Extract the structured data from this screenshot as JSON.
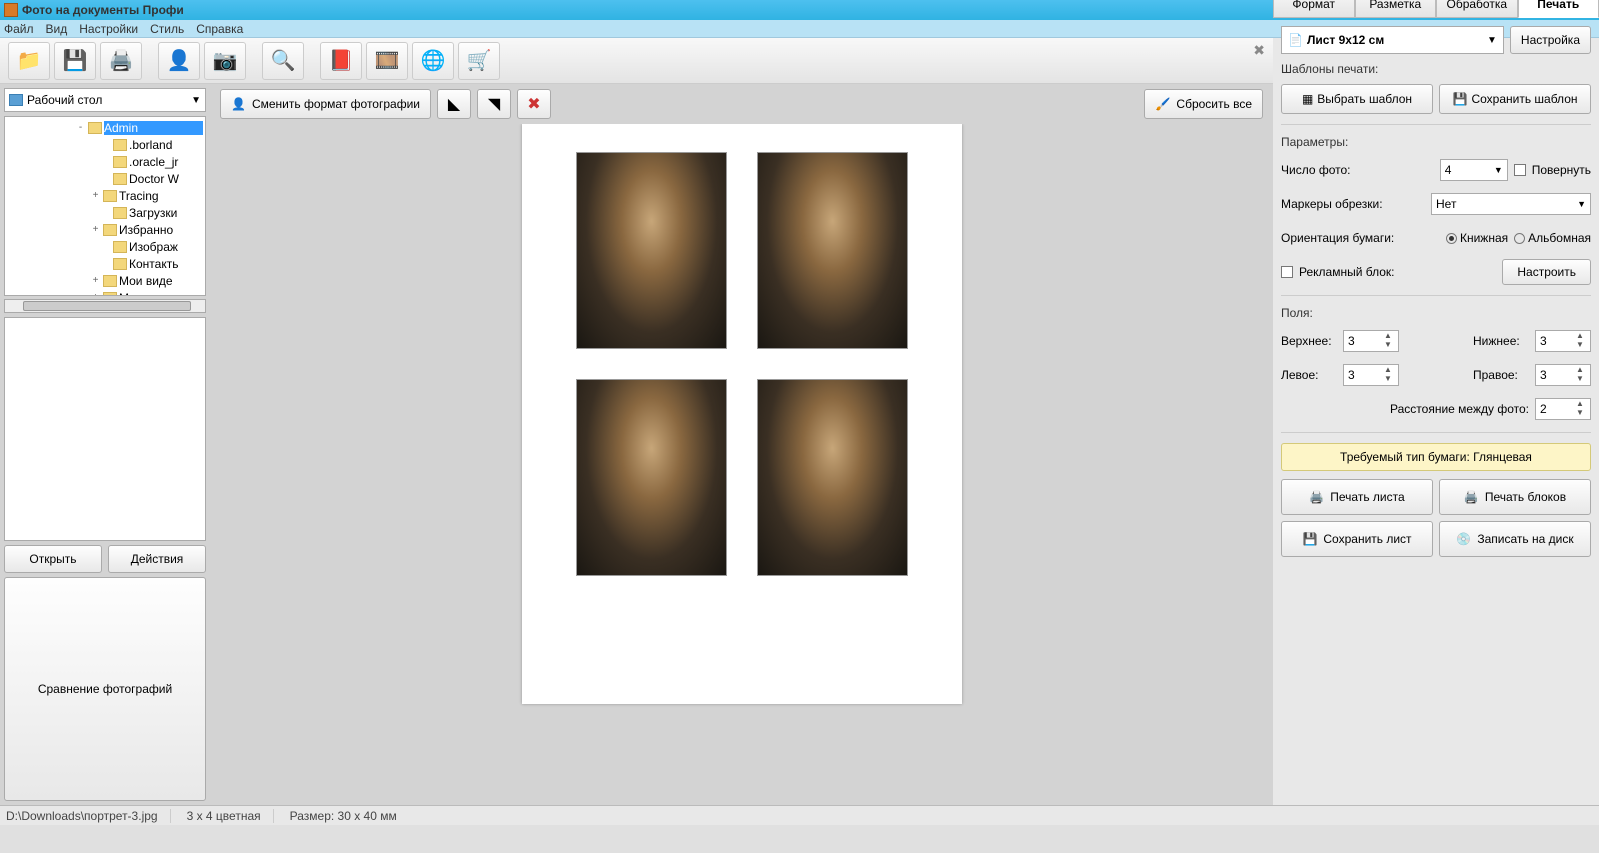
{
  "title": "Фото на документы Профи",
  "menu": [
    "Файл",
    "Вид",
    "Настройки",
    "Стиль",
    "Справка"
  ],
  "leftPanel": {
    "rootCombo": "Рабочий стол",
    "tree": [
      {
        "indent": 70,
        "exp": "-",
        "label": "Admin",
        "selected": true
      },
      {
        "indent": 95,
        "exp": "",
        "label": ".borland"
      },
      {
        "indent": 95,
        "exp": "",
        "label": ".oracle_jr"
      },
      {
        "indent": 95,
        "exp": "",
        "label": "Doctor W"
      },
      {
        "indent": 85,
        "exp": "+",
        "label": "Tracing"
      },
      {
        "indent": 95,
        "exp": "",
        "label": "Загрузки"
      },
      {
        "indent": 85,
        "exp": "+",
        "label": "Избранно"
      },
      {
        "indent": 95,
        "exp": "",
        "label": "Изображ"
      },
      {
        "indent": 95,
        "exp": "",
        "label": "Контакть"
      },
      {
        "indent": 85,
        "exp": "+",
        "label": "Мои виде"
      },
      {
        "indent": 85,
        "exp": "+",
        "label": "Мои доку"
      }
    ],
    "openBtn": "Открыть",
    "actionsBtn": "Действия",
    "compareBtn": "Сравнение фотографий"
  },
  "centerBar": {
    "changeFormat": "Сменить формат фотографии",
    "resetAll": "Сбросить все"
  },
  "rightPanel": {
    "tabs": [
      "Формат",
      "Разметка",
      "Обработка",
      "Печать"
    ],
    "activeTab": 3,
    "sheetSelect": "Лист 9x12 см",
    "settingsBtn": "Настройка",
    "templatesLabel": "Шаблоны печати:",
    "selectTemplate": "Выбрать шаблон",
    "saveTemplate": "Сохранить шаблон",
    "paramsLabel": "Параметры:",
    "photoCountLabel": "Число фото:",
    "photoCount": "4",
    "rotateLabel": "Повернуть",
    "cropMarkersLabel": "Маркеры обрезки:",
    "cropMarkers": "Нет",
    "orientationLabel": "Ориентация бумаги:",
    "orientationPortrait": "Книжная",
    "orientationLandscape": "Альбомная",
    "adBlockLabel": "Рекламный блок:",
    "configureBtn": "Настроить",
    "marginsLabel": "Поля:",
    "marginTop": {
      "label": "Верхнее:",
      "value": "3"
    },
    "marginBottom": {
      "label": "Нижнее:",
      "value": "3"
    },
    "marginLeft": {
      "label": "Левое:",
      "value": "3"
    },
    "marginRight": {
      "label": "Правое:",
      "value": "3"
    },
    "spacingLabel": "Расстояние между фото:",
    "spacingValue": "2",
    "paperReq": "Требуемый тип бумаги: Глянцевая",
    "printSheet": "Печать листа",
    "printBlocks": "Печать блоков",
    "saveSheet": "Сохранить лист",
    "burnDisk": "Записать на диск"
  },
  "status": {
    "path": "D:\\Downloads\\портрет-3.jpg",
    "mode": "3 x 4 цветная",
    "sizeLabel": "Размер: 30 x 40 мм"
  }
}
